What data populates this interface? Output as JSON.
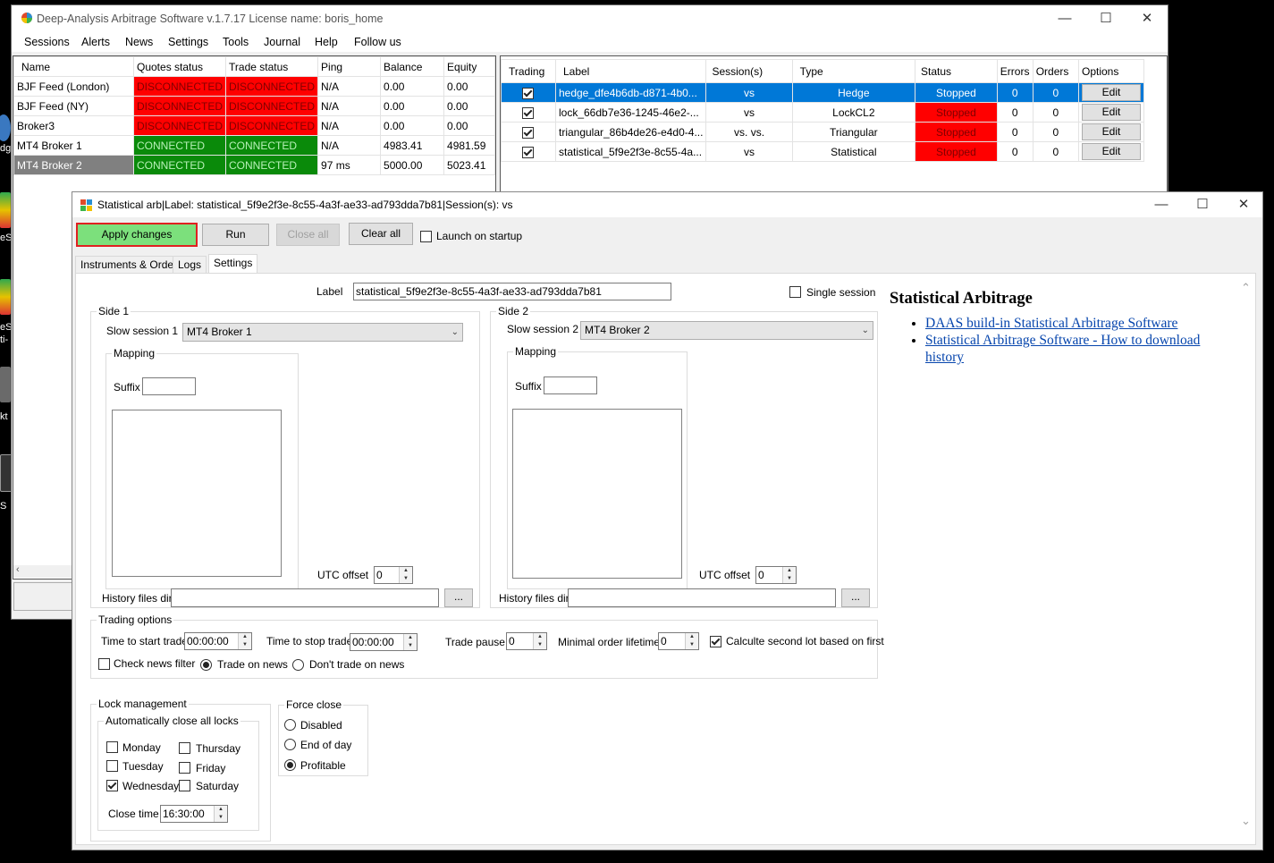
{
  "desktop": {
    "labels": [
      "dge",
      "eS",
      "ti-",
      "eS",
      "kt",
      "S"
    ]
  },
  "main": {
    "title": "Deep-Analysis Arbitrage Software v.1.7.17 License name: boris_home",
    "menu": [
      "Sessions",
      "Alerts",
      "News",
      "Settings",
      "Tools",
      "Journal",
      "Help",
      "Follow us"
    ],
    "sessions": {
      "headers": [
        "Name",
        "Quotes status",
        "Trade status",
        "Ping",
        "Balance",
        "Equity"
      ],
      "rows": [
        {
          "name": "BJF Feed (London)",
          "quotes": "DISCONNECTED",
          "trade": "DISCONNECTED",
          "ping": "N/A",
          "balance": "0.00",
          "equity": "0.00"
        },
        {
          "name": "BJF Feed (NY)",
          "quotes": "DISCONNECTED",
          "trade": "DISCONNECTED",
          "ping": "N/A",
          "balance": "0.00",
          "equity": "0.00"
        },
        {
          "name": "Broker3",
          "quotes": "DISCONNECTED",
          "trade": "DISCONNECTED",
          "ping": "N/A",
          "balance": "0.00",
          "equity": "0.00"
        },
        {
          "name": "MT4 Broker 1",
          "quotes": "CONNECTED",
          "trade": "CONNECTED",
          "ping": "N/A",
          "balance": "4983.41",
          "equity": "4981.59"
        },
        {
          "name": "MT4 Broker 2",
          "quotes": "CONNECTED",
          "trade": "CONNECTED",
          "ping": "97 ms",
          "balance": "5000.00",
          "equity": "5023.41"
        }
      ]
    },
    "strategies": {
      "headers": [
        "Trading",
        "Label",
        "Session(s)",
        "Type",
        "Status",
        "Errors",
        "Orders",
        "Options"
      ],
      "rows": [
        {
          "label": "hedge_dfe4b6db-d871-4b0...",
          "sessions": "vs",
          "type": "Hedge",
          "status": "Stopped",
          "errors": "0",
          "orders": "0",
          "option": "Edit"
        },
        {
          "label": "lock_66db7e36-1245-46e2-...",
          "sessions": "vs",
          "type": "LockCL2",
          "status": "Stopped",
          "errors": "0",
          "orders": "0",
          "option": "Edit"
        },
        {
          "label": "triangular_86b4de26-e4d0-4...",
          "sessions": "vs.  vs.",
          "type": "Triangular",
          "status": "Stopped",
          "errors": "0",
          "orders": "0",
          "option": "Edit"
        },
        {
          "label": "statistical_5f9e2f3e-8c55-4a...",
          "sessions": "vs",
          "type": "Statistical",
          "status": "Stopped",
          "errors": "0",
          "orders": "0",
          "option": "Edit"
        }
      ]
    }
  },
  "dialog": {
    "title": "Statistical arb|Label: statistical_5f9e2f3e-8c55-4a3f-ae33-ad793dda7b81|Session(s):  vs",
    "toolbar": {
      "apply": "Apply changes",
      "run": "Run",
      "close_all": "Close all",
      "clear_all": "Clear all",
      "launch_on_startup": "Launch on startup"
    },
    "tabs": [
      "Instruments & Orders",
      "Logs",
      "Settings"
    ],
    "settings": {
      "label_caption": "Label",
      "label_value": "statistical_5f9e2f3e-8c55-4a3f-ae33-ad793dda7b81",
      "single_session": "Single session",
      "side1": {
        "title": "Side 1",
        "session_caption": "Slow session 1",
        "session_value": "MT4 Broker 1",
        "mapping": "Mapping",
        "suffix": "Suffix",
        "utc_caption": "UTC offset",
        "utc_value": "0",
        "history_caption": "History files dir",
        "browse": "..."
      },
      "side2": {
        "title": "Side 2",
        "session_caption": "Slow session 2",
        "session_value": "MT4 Broker 2",
        "mapping": "Mapping",
        "suffix": "Suffix",
        "utc_caption": "UTC offset",
        "utc_value": "0",
        "history_caption": "History files dir",
        "browse": "..."
      },
      "trading": {
        "title": "Trading options",
        "start_caption": "Time to start trade",
        "start_value": "00:00:00",
        "stop_caption": "Time to stop trade",
        "stop_value": "00:00:00",
        "pause_caption": "Trade pause",
        "pause_value": "0",
        "lifetime_caption": "Minimal order lifetime",
        "lifetime_value": "0",
        "second_lot": "Calculte second lot based on first",
        "check_news": "Check news filter",
        "trade_on_news": "Trade on news",
        "dont_trade_on_news": "Don't trade on news"
      },
      "lock": {
        "title": "Lock management",
        "auto_close": "Automatically close all locks",
        "days": [
          "Monday",
          "Thursday",
          "Tuesday",
          "Friday",
          "Wednesday",
          "Saturday"
        ],
        "close_time_caption": "Close time",
        "close_time_value": "16:30:00"
      },
      "force_close": {
        "title": "Force close",
        "options": [
          "Disabled",
          "End of day",
          "Profitable"
        ]
      }
    },
    "help": {
      "heading": "Statistical Arbitrage",
      "links": [
        "DAAS build-in Statistical Arbitrage Software",
        "Statistical Arbitrage Software - How to download history"
      ]
    }
  }
}
